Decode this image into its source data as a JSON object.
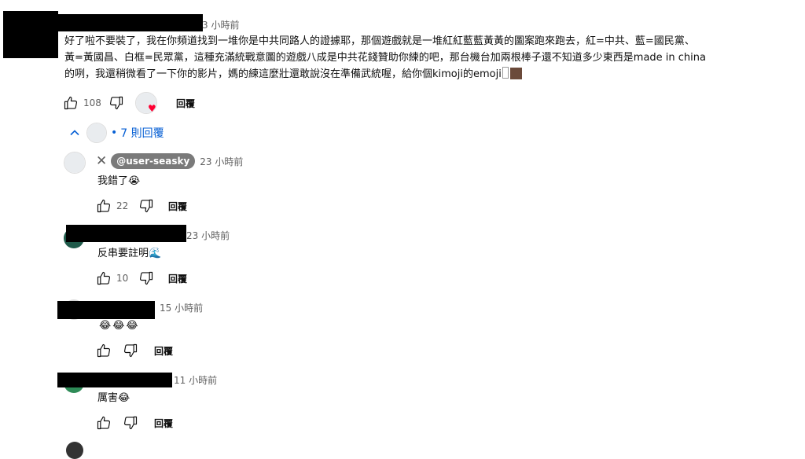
{
  "main_comment": {
    "timestamp": "3 小時前",
    "text_lines": [
      "好了啦不要裝了，我在你頻道找到一堆你是中共同路人的證據耶，那個遊戲就是一堆紅紅藍藍黃黃的圖案跑來跑去，紅=中共、藍=國民黨、",
      "黃=黃國昌、白框=民眾黨，這種充滿統戰意圖的遊戲八成是中共花錢贊助你練的吧，那台機台加兩根棒子還不知道多少東西是made in china",
      "的咧，我還稍微看了一下你的影片，媽的練這麼壯還敢說沒在準備武統喔，給你個kimoji的emoji"
    ],
    "likes": "108",
    "reply_label": "回覆"
  },
  "replies_toggle": {
    "chevron": "^",
    "separator": "•",
    "label": "7 則回覆"
  },
  "replies": [
    {
      "handle": "@user-seasky",
      "timestamp": "23 小時前",
      "text": "我錯了",
      "emoji": "😭",
      "likes": "22",
      "reply_label": "回覆"
    },
    {
      "timestamp": "23 小時前",
      "text": "反串要註明",
      "emoji": "🌊",
      "likes": "10",
      "reply_label": "回覆"
    },
    {
      "timestamp": "15 小時前",
      "text": "",
      "emoji": "😂😂😂",
      "likes": "",
      "reply_label": "回覆"
    },
    {
      "timestamp": "11 小時前",
      "text": "厲害",
      "emoji": "😂",
      "likes": "",
      "reply_label": "回覆"
    }
  ],
  "icons": {
    "like": "thumbs-up-icon",
    "dislike": "thumbs-down-icon",
    "close": "close-icon",
    "chevron": "chevron-up-icon",
    "heart": "heart-icon"
  },
  "colors": {
    "link_blue": "#065fd4",
    "muted_text": "#606060",
    "heart_red": "#ff0033"
  }
}
